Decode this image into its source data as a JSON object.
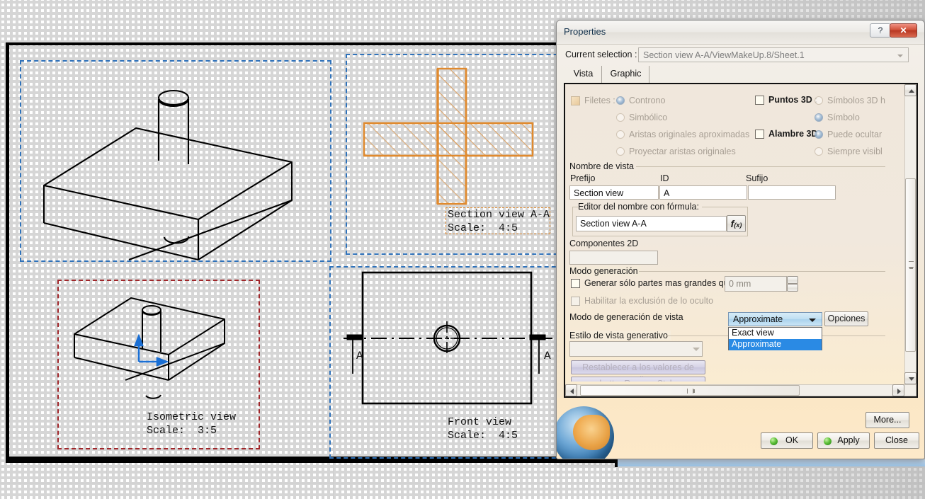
{
  "cad": {
    "views": [
      {
        "label_line1": "Section view A-A",
        "label_line2": "Scale:  4:5"
      },
      {
        "label_line1": "Isometric view",
        "label_line2": "Scale:  3:5"
      },
      {
        "label_line1": "Front view",
        "label_line2": "Scale:  4:5"
      }
    ],
    "section_marks": {
      "left": "A",
      "right": "A"
    },
    "colors": {
      "selected_view": "#e08a2e",
      "frame_active": "#2f72ba",
      "frame_current": "#a0272b",
      "geometry": "#000000",
      "axis": "#1a6fd4"
    }
  },
  "dialog": {
    "title": "Properties",
    "titlebar_buttons": {
      "help": "?",
      "close": "✕"
    },
    "current_selection": {
      "label": "Current selection :",
      "value": "Section view A-A/ViewMakeUp.8/Sheet.1"
    },
    "tabs": [
      {
        "label": "Vista",
        "active": true
      },
      {
        "label": "Graphic",
        "active": false
      }
    ],
    "fillets": {
      "label": "Filetes :",
      "options": [
        {
          "label": "Controno",
          "selected": true
        },
        {
          "label": "Simbólico",
          "selected": false
        },
        {
          "label": "Aristas originales aproximadas",
          "selected": false
        },
        {
          "label": "Proyectar aristas originales",
          "selected": false
        }
      ]
    },
    "points3d": {
      "label": "Puntos 3D :",
      "checked": false,
      "options": [
        {
          "label": "Símbolos 3D h",
          "selected": false
        },
        {
          "label": "Símbolo",
          "selected": true
        }
      ]
    },
    "wire3d": {
      "label": "Alambre 3D",
      "checked": false,
      "options": [
        {
          "label": "Puede ocultar",
          "selected": true
        },
        {
          "label": "Siempre visibl",
          "selected": false
        }
      ]
    },
    "view_name": {
      "group_title": "Nombre de vista",
      "columns": [
        "Prefijo",
        "ID",
        "Sufijo"
      ],
      "prefix": "Section view",
      "id": "A",
      "suffix": "",
      "formula_editor": {
        "title": "Editor del nombre con fórmula:",
        "value": "Section view A-A",
        "button_icon": "fx-icon"
      }
    },
    "components_2d": {
      "label": "Componentes 2D",
      "value": ""
    },
    "generation": {
      "group_title": "Modo generación",
      "only_parts_bigger": {
        "label": "Generar sólo partes mas grandes que",
        "checked": false,
        "value": "0 mm"
      },
      "enable_hidden_exclusion": {
        "label": "Habilitar la exclusión de lo oculto",
        "checked": false
      },
      "view_generation_mode": {
        "label": "Modo de generación de vista",
        "value": "Approximate",
        "options": [
          "Exact view",
          "Approximate"
        ],
        "selected_option": "Approximate",
        "options_button": "Opciones"
      }
    },
    "generative_style": {
      "group_title": "Estilo de vista generativo",
      "value": "",
      "buttons": [
        "Restablecer a los valores de estilo",
        "buttonRemoveStyle"
      ]
    },
    "footer_buttons": {
      "more": "More...",
      "ok": "OK",
      "apply": "Apply",
      "close": "Close"
    }
  }
}
